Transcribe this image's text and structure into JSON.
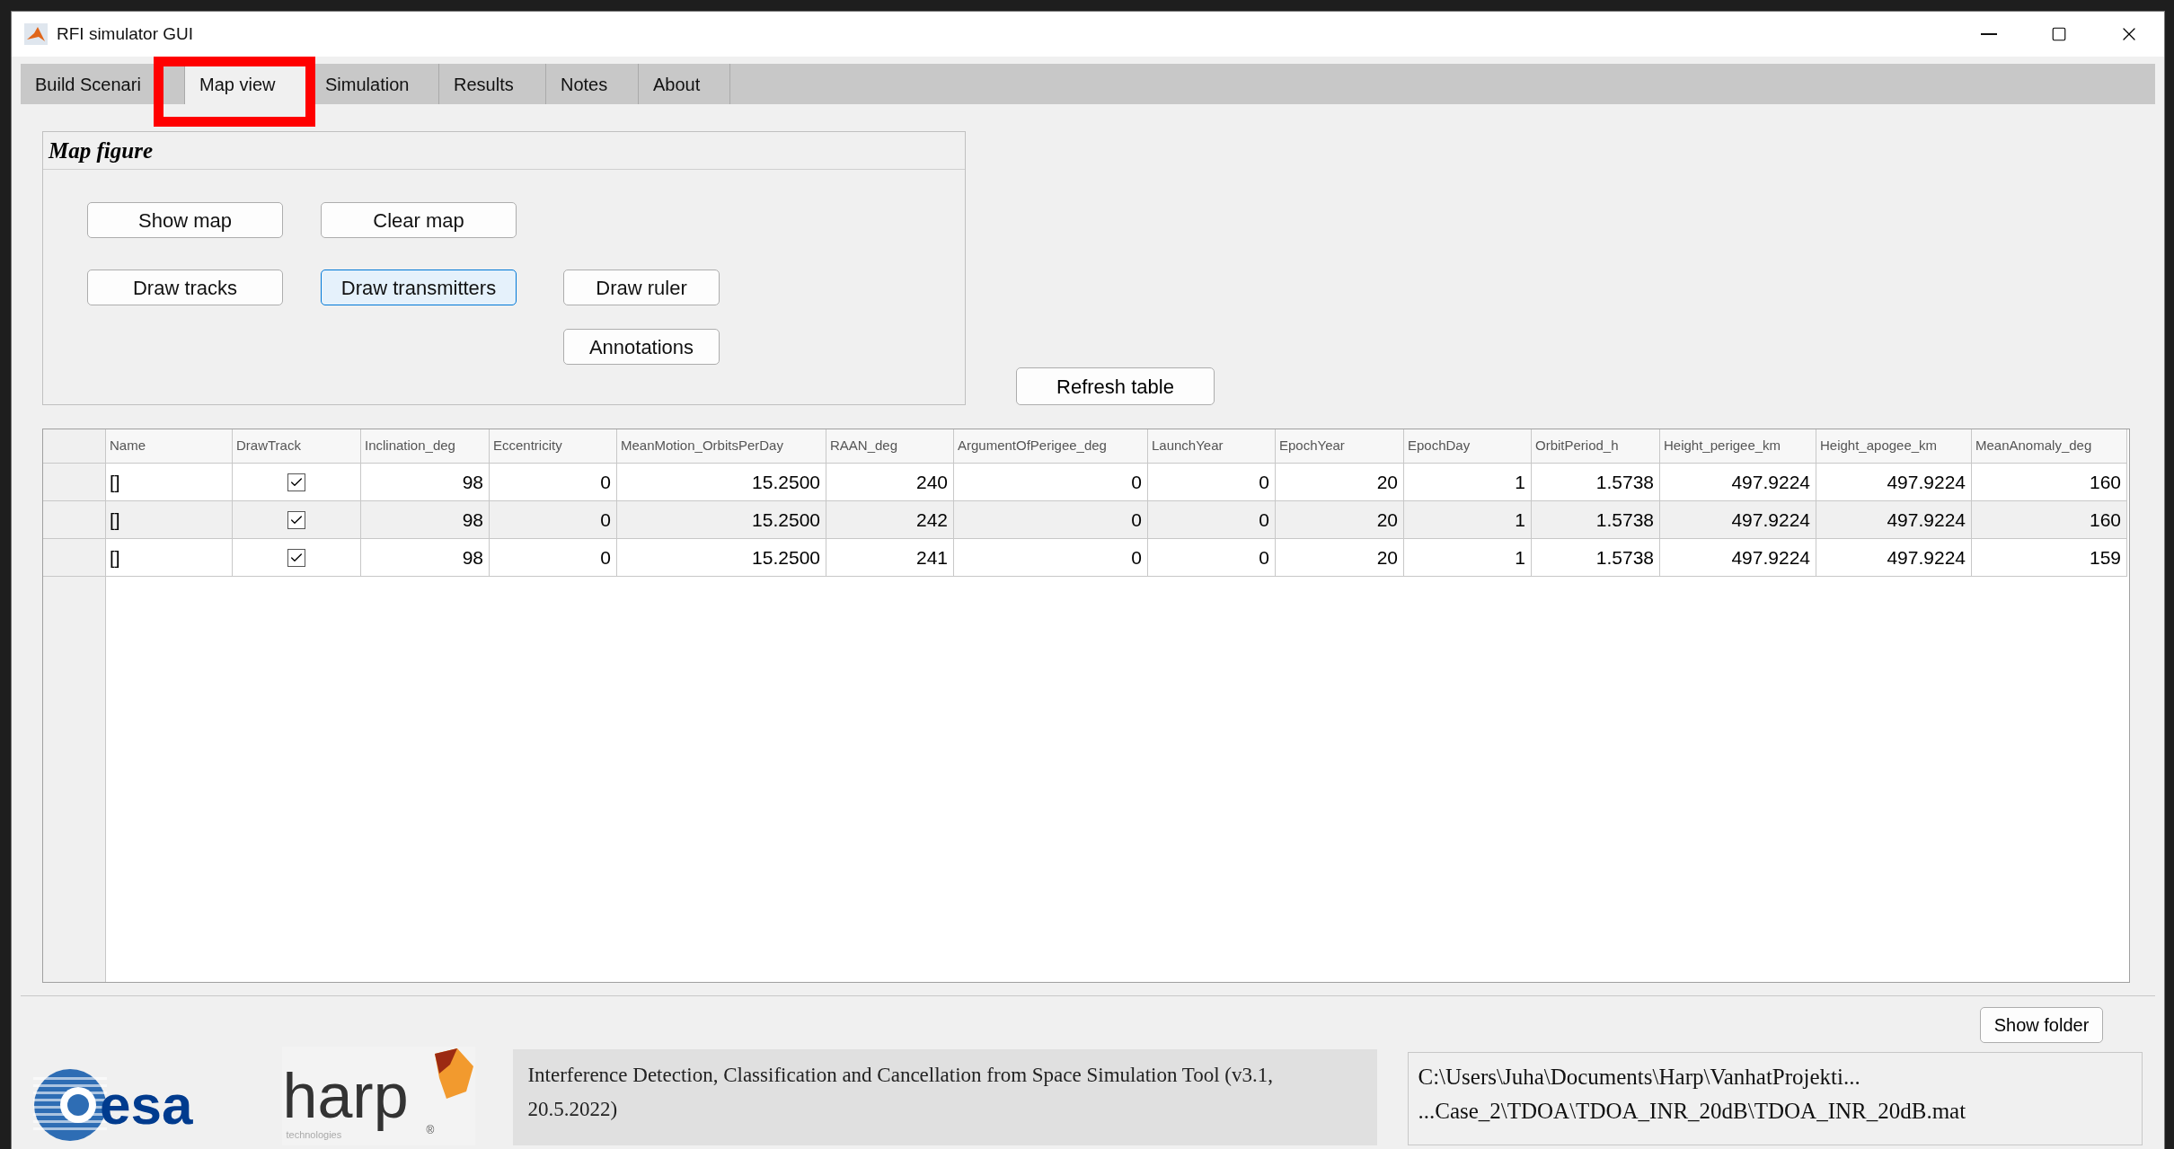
{
  "window": {
    "title": "RFI simulator GUI"
  },
  "tabs": [
    {
      "label": "Build Scenari",
      "selected": false,
      "highlighted": false
    },
    {
      "label": "Map view",
      "selected": true,
      "highlighted": true
    },
    {
      "label": "Simulation",
      "selected": false,
      "highlighted": false
    },
    {
      "label": "Results",
      "selected": false,
      "highlighted": false
    },
    {
      "label": "Notes",
      "selected": false,
      "highlighted": false
    },
    {
      "label": "About",
      "selected": false,
      "highlighted": false
    }
  ],
  "map_panel": {
    "title": "Map figure",
    "button_rows": [
      [
        {
          "label": "Show map",
          "focused": false
        },
        {
          "label": "Clear map",
          "focused": false
        }
      ],
      [
        {
          "label": "Draw tracks",
          "focused": false
        },
        {
          "label": "Draw transmitters",
          "focused": true
        },
        {
          "label": "Draw ruler",
          "focused": false
        }
      ],
      [
        {
          "label": "Annotations",
          "focused": false
        }
      ]
    ]
  },
  "refresh_button": "Refresh table",
  "table": {
    "columns": [
      "Name",
      "DrawTrack",
      "Inclination_deg",
      "Eccentricity",
      "MeanMotion_OrbitsPerDay",
      "RAAN_deg",
      "ArgumentOfPerigee_deg",
      "LaunchYear",
      "EpochYear",
      "EpochDay",
      "OrbitPeriod_h",
      "Height_perigee_km",
      "Height_apogee_km",
      "MeanAnomaly_deg"
    ],
    "rows": [
      {
        "name": "[]",
        "draw_track": true,
        "values": [
          "98",
          "0",
          "15.2500",
          "240",
          "0",
          "0",
          "20",
          "1",
          "1.5738",
          "497.9224",
          "497.9224",
          "160"
        ]
      },
      {
        "name": "[]",
        "draw_track": true,
        "values": [
          "98",
          "0",
          "15.2500",
          "242",
          "0",
          "0",
          "20",
          "1",
          "1.5738",
          "497.9224",
          "497.9224",
          "160"
        ]
      },
      {
        "name": "[]",
        "draw_track": true,
        "values": [
          "98",
          "0",
          "15.2500",
          "241",
          "0",
          "0",
          "20",
          "1",
          "1.5738",
          "497.9224",
          "497.9224",
          "159"
        ]
      }
    ]
  },
  "show_folder_button": "Show folder",
  "logos": {
    "esa": "esa",
    "harp": "harp",
    "harp_sub": "technologies",
    "harp_mark": "®"
  },
  "info_text": "Interference Detection, Classification and Cancellation from Space Simulation Tool (v3.1, 20.5.2022)",
  "path_lines": [
    "C:\\Users\\Juha\\Documents\\Harp\\VanhatProjekti...",
    "...Case_2\\TDOA\\TDOA_INR_20dB\\TDOA_INR_20dB.mat"
  ]
}
